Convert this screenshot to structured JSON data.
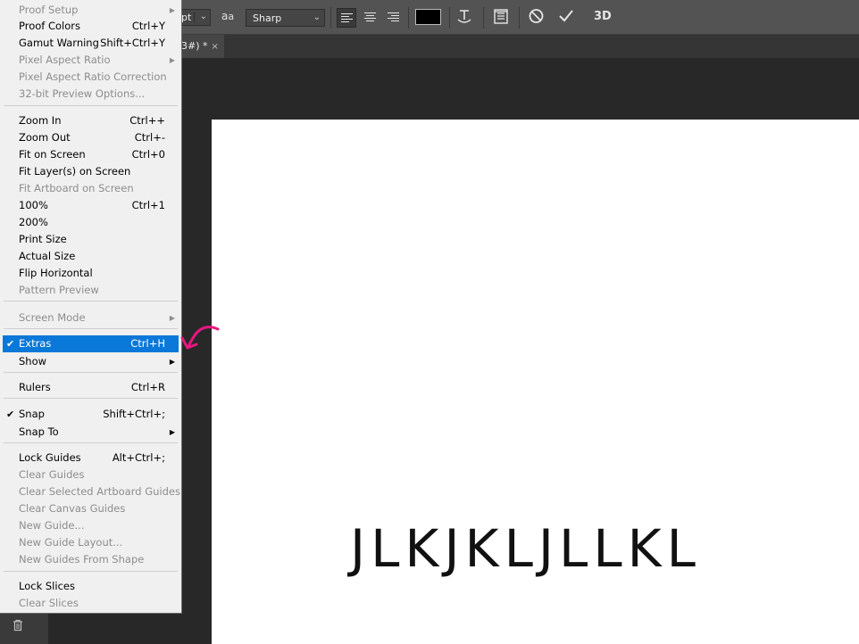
{
  "options_bar": {
    "font_size_value": "pt",
    "antialias_icon_text": "a",
    "antialias_icon_text_small": "a",
    "antialias_value": "Sharp",
    "icons": [
      "align-left-icon",
      "align-center-icon",
      "align-right-icon",
      "text-color-swatch",
      "warp-text-icon",
      "character-panel-icon",
      "cancel-icon",
      "commit-icon",
      "3d-icon"
    ],
    "three_d_label": "3D",
    "text_color": "#000000"
  },
  "document_tab": {
    "title": "3#) *",
    "close": "×"
  },
  "canvas": {
    "text": "JLKJKLJLLKL"
  },
  "menu": {
    "items": [
      {
        "label": "Proof Setup",
        "shortcut": "",
        "submenu": true,
        "enabled": false,
        "checked": false
      },
      {
        "label": "Proof Colors",
        "shortcut": "Ctrl+Y",
        "submenu": false,
        "enabled": true,
        "checked": false
      },
      {
        "label": "Gamut Warning",
        "shortcut": "Shift+Ctrl+Y",
        "submenu": false,
        "enabled": true,
        "checked": false
      },
      {
        "label": "Pixel Aspect Ratio",
        "shortcut": "",
        "submenu": true,
        "enabled": false,
        "checked": false
      },
      {
        "label": "Pixel Aspect Ratio Correction",
        "shortcut": "",
        "submenu": false,
        "enabled": false,
        "checked": false
      },
      {
        "label": "32-bit Preview Options...",
        "shortcut": "",
        "submenu": false,
        "enabled": false,
        "checked": false
      },
      {
        "label": "Zoom In",
        "shortcut": "Ctrl++",
        "submenu": false,
        "enabled": true,
        "checked": false
      },
      {
        "label": "Zoom Out",
        "shortcut": "Ctrl+-",
        "submenu": false,
        "enabled": true,
        "checked": false
      },
      {
        "label": "Fit on Screen",
        "shortcut": "Ctrl+0",
        "submenu": false,
        "enabled": true,
        "checked": false
      },
      {
        "label": "Fit Layer(s) on Screen",
        "shortcut": "",
        "submenu": false,
        "enabled": true,
        "checked": false
      },
      {
        "label": "Fit Artboard on Screen",
        "shortcut": "",
        "submenu": false,
        "enabled": false,
        "checked": false
      },
      {
        "label": "100%",
        "shortcut": "Ctrl+1",
        "submenu": false,
        "enabled": true,
        "checked": false
      },
      {
        "label": "200%",
        "shortcut": "",
        "submenu": false,
        "enabled": true,
        "checked": false
      },
      {
        "label": "Print Size",
        "shortcut": "",
        "submenu": false,
        "enabled": true,
        "checked": false
      },
      {
        "label": "Actual Size",
        "shortcut": "",
        "submenu": false,
        "enabled": true,
        "checked": false
      },
      {
        "label": "Flip Horizontal",
        "shortcut": "",
        "submenu": false,
        "enabled": true,
        "checked": false
      },
      {
        "label": "Pattern Preview",
        "shortcut": "",
        "submenu": false,
        "enabled": false,
        "checked": false
      },
      {
        "label": "Screen Mode",
        "shortcut": "",
        "submenu": true,
        "enabled": false,
        "checked": false
      },
      {
        "label": "Extras",
        "shortcut": "Ctrl+H",
        "submenu": false,
        "enabled": true,
        "checked": true,
        "highlighted": true
      },
      {
        "label": "Show",
        "shortcut": "",
        "submenu": true,
        "enabled": true,
        "checked": false
      },
      {
        "label": "Rulers",
        "shortcut": "Ctrl+R",
        "submenu": false,
        "enabled": true,
        "checked": false
      },
      {
        "label": "Snap",
        "shortcut": "Shift+Ctrl+;",
        "submenu": false,
        "enabled": true,
        "checked": true
      },
      {
        "label": "Snap To",
        "shortcut": "",
        "submenu": true,
        "enabled": true,
        "checked": false
      },
      {
        "label": "Lock Guides",
        "shortcut": "Alt+Ctrl+;",
        "submenu": false,
        "enabled": true,
        "checked": false
      },
      {
        "label": "Clear Guides",
        "shortcut": "",
        "submenu": false,
        "enabled": false,
        "checked": false
      },
      {
        "label": "Clear Selected Artboard Guides",
        "shortcut": "",
        "submenu": false,
        "enabled": false,
        "checked": false
      },
      {
        "label": "Clear Canvas Guides",
        "shortcut": "",
        "submenu": false,
        "enabled": false,
        "checked": false
      },
      {
        "label": "New Guide...",
        "shortcut": "",
        "submenu": false,
        "enabled": false,
        "checked": false
      },
      {
        "label": "New Guide Layout...",
        "shortcut": "",
        "submenu": false,
        "enabled": false,
        "checked": false
      },
      {
        "label": "New Guides From Shape",
        "shortcut": "",
        "submenu": false,
        "enabled": false,
        "checked": false
      },
      {
        "label": "Lock Slices",
        "shortcut": "",
        "submenu": false,
        "enabled": true,
        "checked": false
      },
      {
        "label": "Clear Slices",
        "shortcut": "",
        "submenu": false,
        "enabled": false,
        "checked": false
      }
    ],
    "check_glyph": "✔",
    "submenu_glyph": "▶"
  },
  "colors": {
    "menu_bg": "#f0f0f0",
    "highlight": "#0978d8",
    "annotation": "#e8177f",
    "panel_bg": "#535353",
    "workspace_bg": "#282828"
  }
}
